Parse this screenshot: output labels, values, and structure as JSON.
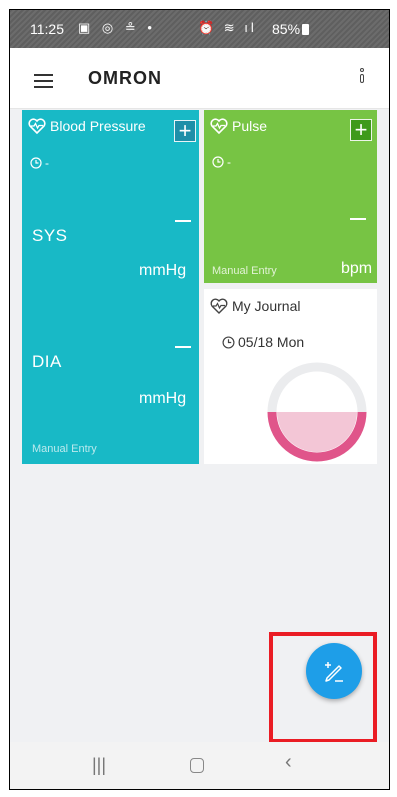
{
  "status_bar": {
    "time": "11:25",
    "battery": "85%"
  },
  "app_bar": {
    "logo": "OMRON",
    "menu_icon": "hamburger-icon",
    "more_icon": "more-vert-icon"
  },
  "cards": {
    "blood_pressure": {
      "title": "Blood Pressure",
      "last_time": "-",
      "sys_label": "SYS",
      "dia_label": "DIA",
      "unit": "mmHg",
      "entry_label": "Manual Entry",
      "color": "#18b9c6"
    },
    "pulse": {
      "title": "Pulse",
      "last_time": "-",
      "unit": "bpm",
      "entry_label": "Manual Entry",
      "color": "#77c444"
    },
    "journal": {
      "title": "My Journal",
      "date": "05/18 Mon"
    }
  },
  "fab": {
    "icon": "edit-plus-icon",
    "color": "#1e9ee8"
  },
  "highlight_color": "#ea1c24",
  "nav": {
    "recent": "recent-apps-icon",
    "home": "home-icon",
    "back": "back-icon"
  }
}
